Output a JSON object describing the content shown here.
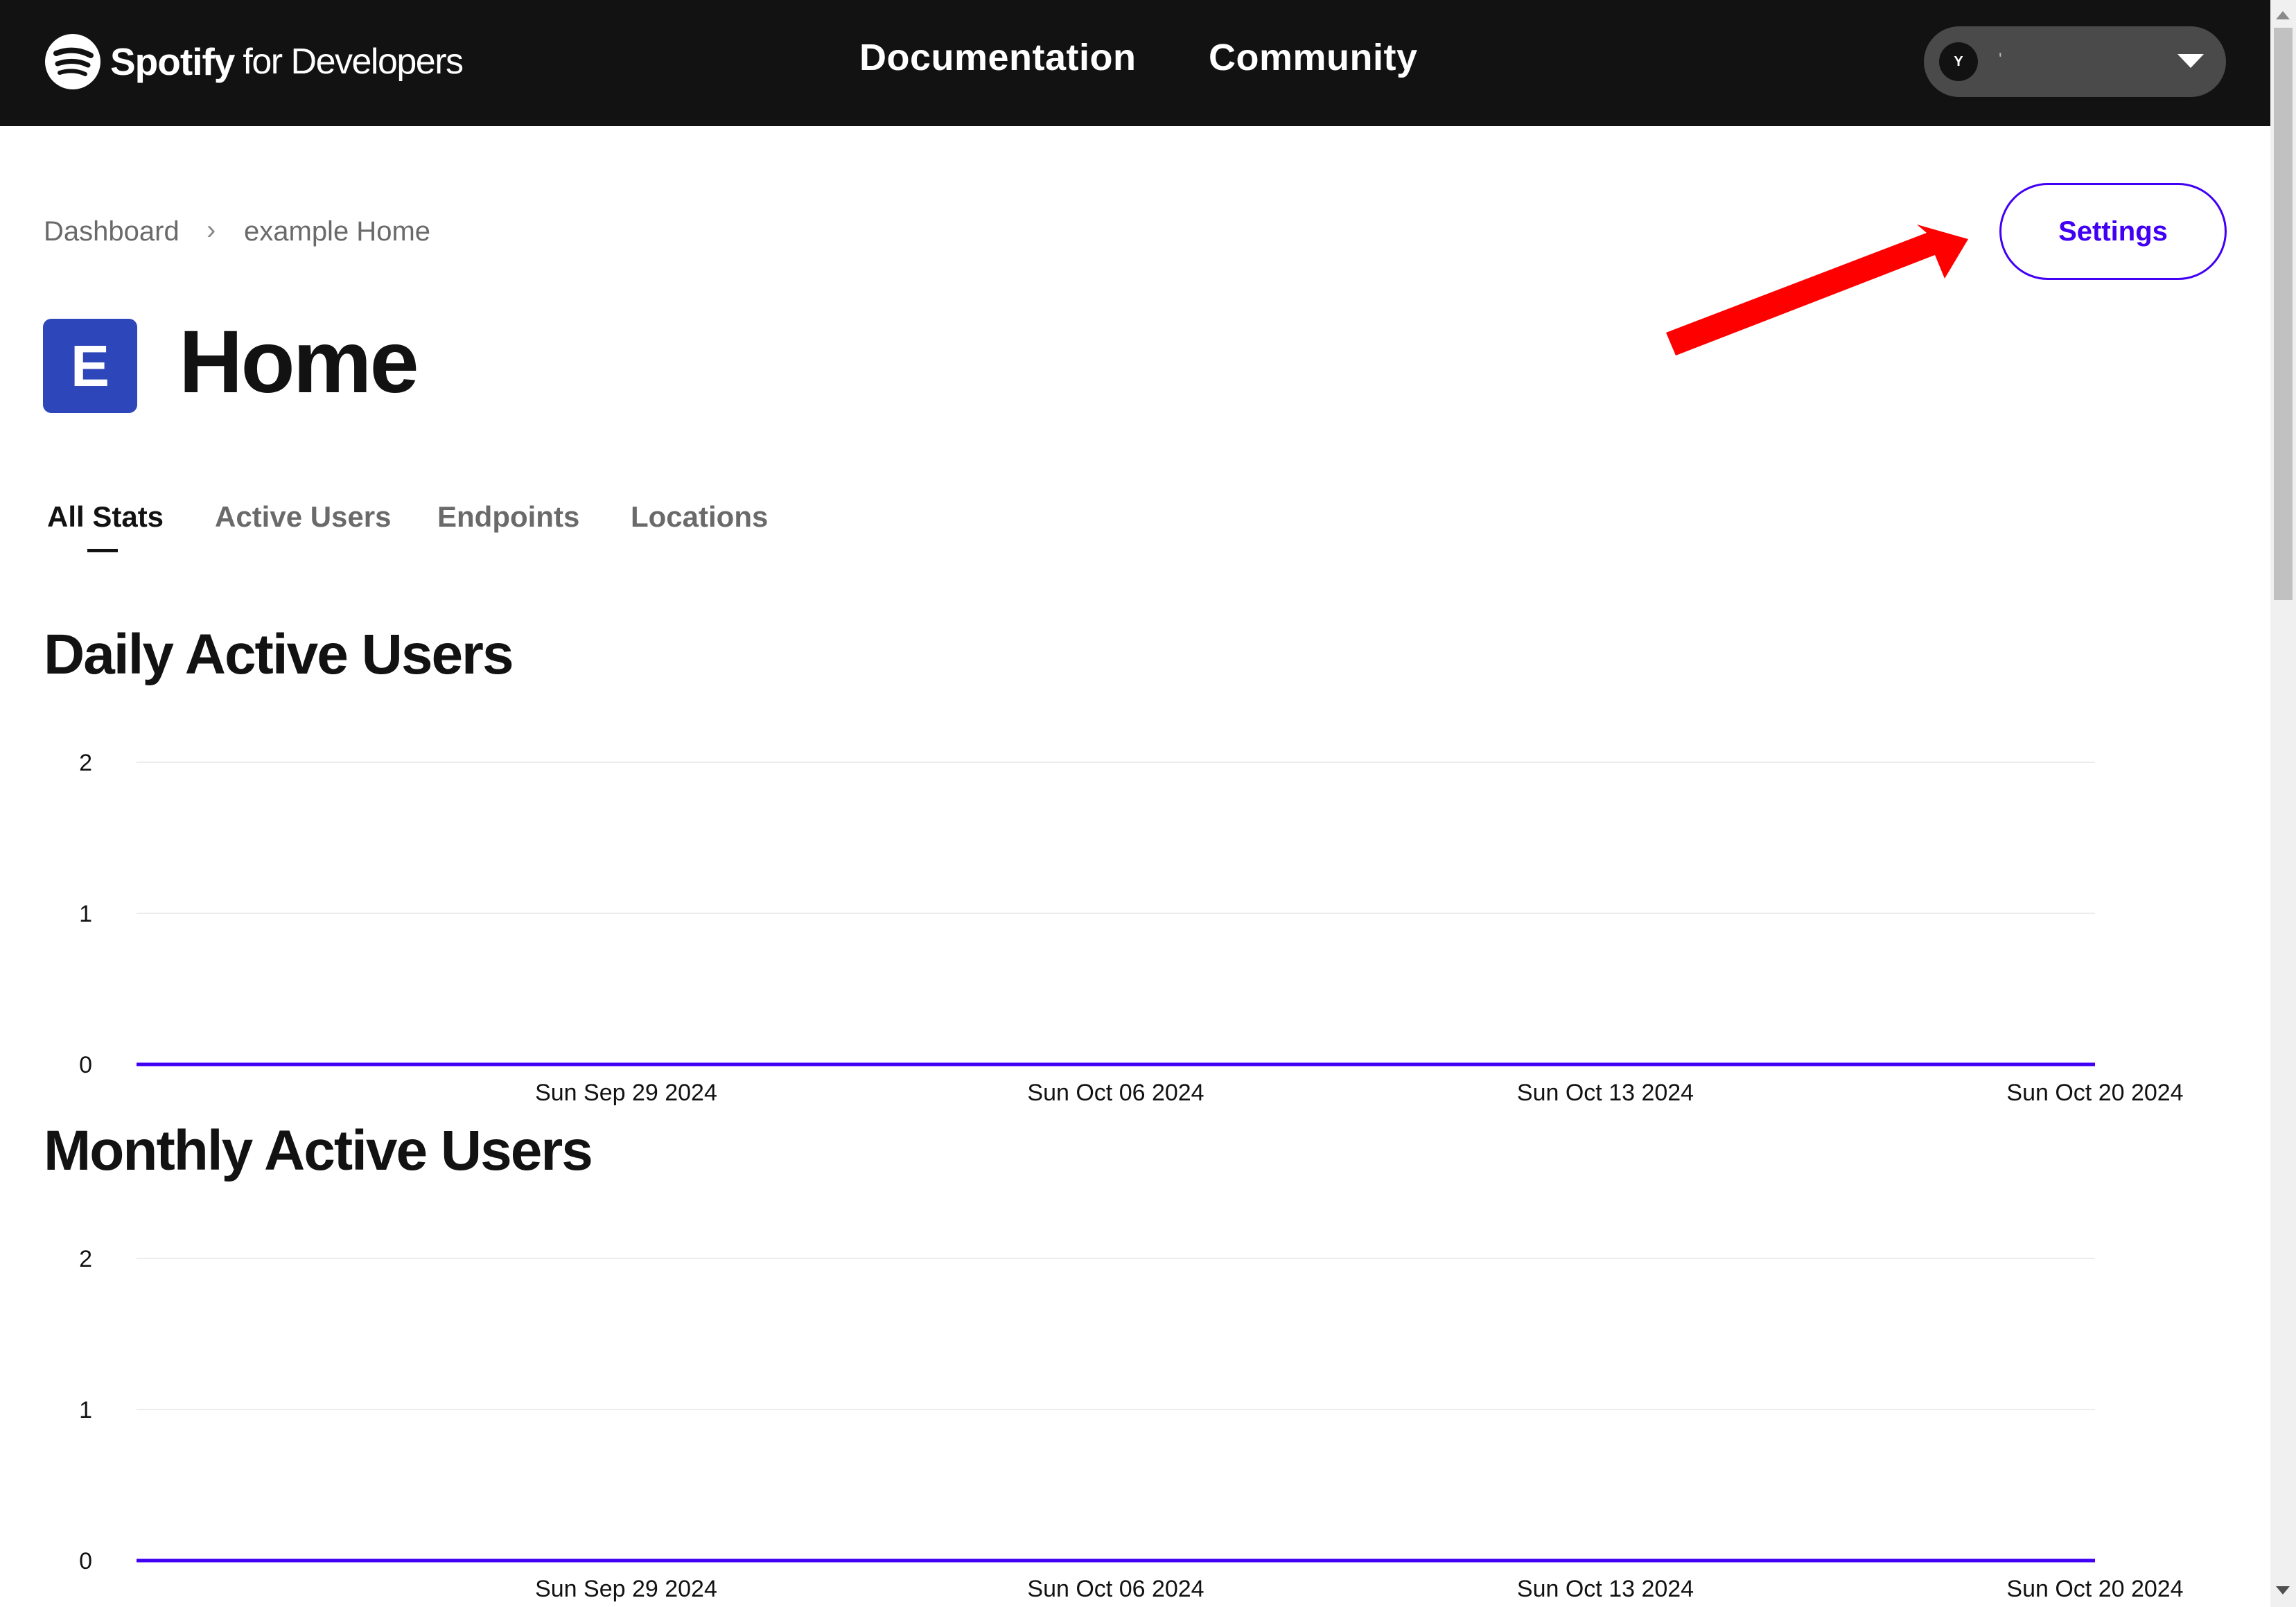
{
  "header": {
    "brand": "Spotify",
    "brand_sub": "for Developers",
    "nav": [
      "Documentation",
      "Community"
    ],
    "user": {
      "initial": "Y",
      "name": "'"
    }
  },
  "breadcrumb": [
    "Dashboard",
    "example Home"
  ],
  "settings_label": "Settings",
  "app": {
    "initial": "E",
    "title": "Home"
  },
  "tabs": [
    "All Stats",
    "Active Users",
    "Endpoints",
    "Locations"
  ],
  "colors": {
    "accent": "#4100f4",
    "app_icon": "#2d46b9",
    "annotation_arrow": "#ff0000",
    "topbar": "#121212"
  },
  "sections": [
    {
      "title": "Daily Active Users"
    },
    {
      "title": "Monthly Active Users"
    }
  ],
  "chart_data": [
    {
      "type": "line",
      "title": "Daily Active Users",
      "y_ticks": [
        "2",
        "1",
        "0"
      ],
      "ylim": [
        0,
        2
      ],
      "x_ticks": [
        "Sun Sep 29 2024",
        "Sun Oct 06 2024",
        "Sun Oct 13 2024",
        "Sun Oct 20 2024"
      ],
      "x_range": [
        "2024-09-22",
        "2024-10-20"
      ],
      "series": [
        {
          "x": [
            "2024-09-22",
            "2024-10-20"
          ],
          "values": [
            0,
            0
          ]
        }
      ],
      "grid": true
    },
    {
      "type": "line",
      "title": "Monthly Active Users",
      "y_ticks": [
        "2",
        "1",
        "0"
      ],
      "ylim": [
        0,
        2
      ],
      "x_ticks": [
        "Sun Sep 29 2024",
        "Sun Oct 06 2024",
        "Sun Oct 13 2024",
        "Sun Oct 20 2024"
      ],
      "x_range": [
        "2024-09-22",
        "2024-10-20"
      ],
      "series": [
        {
          "x": [
            "2024-09-22",
            "2024-10-20"
          ],
          "values": [
            0,
            0
          ]
        }
      ],
      "grid": true
    }
  ]
}
